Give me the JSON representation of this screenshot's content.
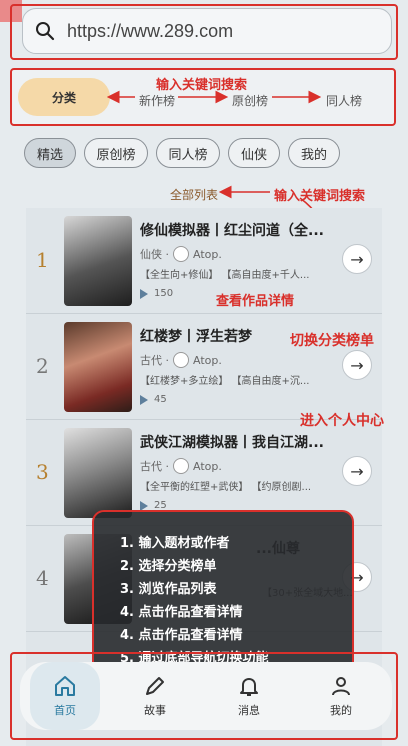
{
  "search": {
    "value": "https://www.289.com"
  },
  "category_tabs": [
    {
      "label": "分类",
      "active": true
    },
    {
      "label": "新作榜"
    },
    {
      "label": "原创榜"
    },
    {
      "label": "同人榜"
    }
  ],
  "filter_chips": [
    {
      "label": "精选",
      "active": true
    },
    {
      "label": "原创榜"
    },
    {
      "label": "同人榜"
    },
    {
      "label": "仙侠"
    },
    {
      "label": "我的"
    }
  ],
  "all_list_label": "全部列表",
  "annotations": {
    "keyword_search_top": "输入关键词搜索",
    "keyword_search_mid": "输入关键词搜索",
    "view_details": "查看作品详情",
    "switch_rank": "切换分类榜单",
    "enter_profile": "进入个人中心"
  },
  "items": [
    {
      "rank": "1",
      "title": "修仙模拟器丨红尘问道（全...",
      "genre": "仙侠 ·",
      "author": "Atop.",
      "tags": "【全生向+修仙】 【高自由度+千人...",
      "plays": "150"
    },
    {
      "rank": "2",
      "title": "红楼梦丨浮生若梦",
      "genre": "古代 ·",
      "author": "Atop.",
      "tags": "【红楼梦+多立绘】 【高自由度+沉...",
      "plays": "45"
    },
    {
      "rank": "3",
      "title": "武侠江湖模拟器丨我自江湖...",
      "genre": "古代 ·",
      "author": "Atop.",
      "tags": "【全平衡的红塑+武侠】 【约原创剧...",
      "plays": "25"
    },
    {
      "rank": "4",
      "title": "...仙尊",
      "genre": "",
      "author": "",
      "tags": "【30+张全域大地...",
      "plays": ""
    }
  ],
  "overlay_steps": [
    "1. 输入题材或作者",
    "2. 选择分类榜单",
    "3. 浏览作品列表",
    "4. 点击作品查看详情",
    "4. 点击作品查看详情",
    "5. 通过底部导航切换功能"
  ],
  "bottom_nav": [
    {
      "label": "首页",
      "icon": "home-icon",
      "active": true
    },
    {
      "label": "故事",
      "icon": "pen-icon"
    },
    {
      "label": "消息",
      "icon": "bell-icon"
    },
    {
      "label": "我的",
      "icon": "user-icon"
    }
  ],
  "colors": {
    "accent_red": "#d9302b",
    "active_tab": "#f5d9a8",
    "active_nav": "#2a7aa0"
  }
}
